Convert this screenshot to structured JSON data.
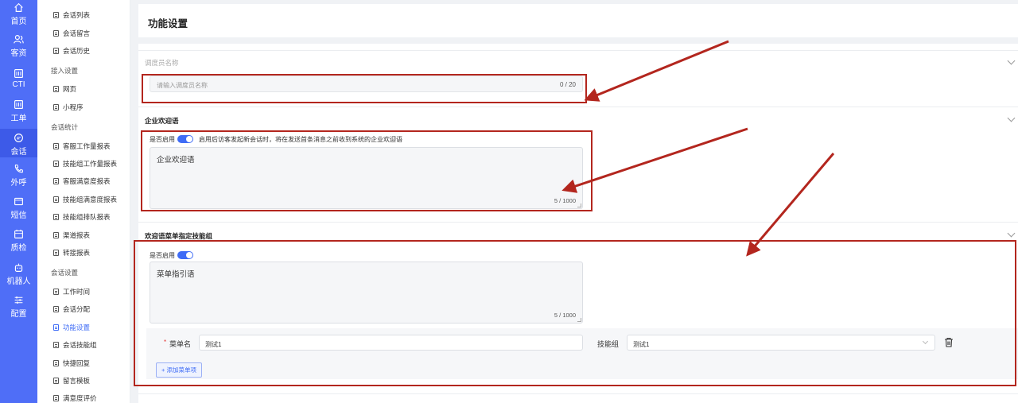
{
  "rail": {
    "items": [
      {
        "label": "首页",
        "icon": "home-icon"
      },
      {
        "label": "客资",
        "icon": "users-icon"
      },
      {
        "label": "CTI",
        "icon": "cti-icon"
      },
      {
        "label": "工单",
        "icon": "ticket-icon"
      },
      {
        "label": "会话",
        "icon": "chat-icon",
        "active": true
      },
      {
        "label": "外呼",
        "icon": "phone-icon"
      },
      {
        "label": "短信",
        "icon": "sms-icon"
      },
      {
        "label": "质检",
        "icon": "calendar-icon"
      },
      {
        "label": "机器人",
        "icon": "robot-icon"
      },
      {
        "label": "配置",
        "icon": "sliders-icon"
      }
    ]
  },
  "subnav": {
    "items": [
      "会话列表",
      "会话留言",
      "会话历史"
    ],
    "group_access": "接入设置",
    "access_items": [
      "网页",
      "小程序"
    ],
    "group_stats": "会话统计",
    "stats_items": [
      "客服工作量报表",
      "技能组工作量报表",
      "客服满意度报表",
      "技能组满意度报表",
      "技能组排队报表",
      "渠道报表",
      "转接报表"
    ],
    "group_settings": "会话设置",
    "settings_items": [
      "工作时间",
      "会话分配",
      "功能设置",
      "会话技能组",
      "快捷回复",
      "留言模板",
      "满意度评价"
    ]
  },
  "page": {
    "title": "功能设置"
  },
  "dispatcher": {
    "title": "调度员名称",
    "placeholder": "请输入调度员名称",
    "count": "0 / 20"
  },
  "welcome": {
    "title": "企业欢迎语",
    "enable_label": "是否启用",
    "enable_on": true,
    "description": "启用后访客发起新会话时，将在发送首条消息之前收到系统的企业欢迎语",
    "text": "企业欢迎语",
    "count": "5 / 1000"
  },
  "menu": {
    "title": "欢迎语菜单指定技能组",
    "enable_label": "是否启用",
    "enable_on": true,
    "guide_text": "菜单指引语",
    "count": "5 / 1000",
    "required_mark": "*",
    "name_label": "菜单名",
    "name_value": "测试1",
    "group_label": "技能组",
    "group_value": "测试1",
    "add_button": "+ 添加菜单项"
  },
  "colors": {
    "rail": "#4f6ef7",
    "accent": "#3f6cf6",
    "annotation": "#b3261e"
  }
}
